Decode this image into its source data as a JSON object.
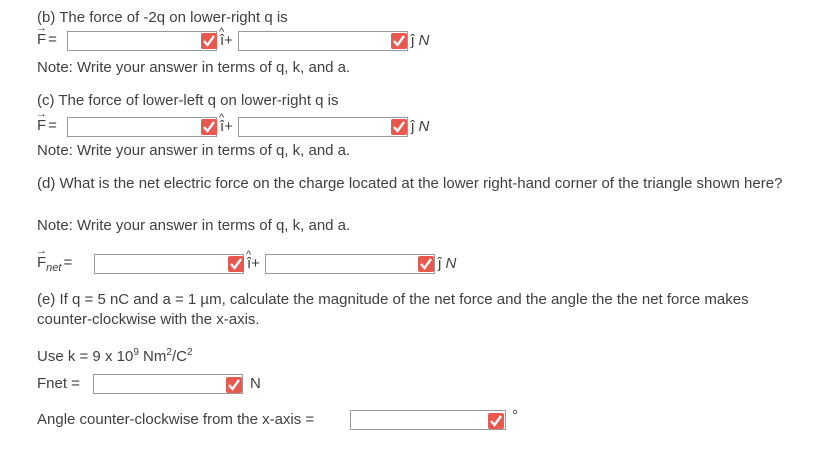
{
  "b": {
    "question": "(b) The force of -2q on lower-right q is",
    "force_symbol": "F",
    "equals": "=",
    "i_unit": "î",
    "plus": "+",
    "j_unit": "ĵ",
    "unit": "N",
    "note": "Note: Write your answer in terms of q, k, and a."
  },
  "c": {
    "question": "(c) The force of lower-left q on lower-right q is",
    "force_symbol": "F",
    "equals": "=",
    "i_unit": "î",
    "plus": "+",
    "j_unit": "ĵ",
    "unit": "N",
    "note": "Note: Write your answer in terms of q, k, and a."
  },
  "d": {
    "question": "(d) What is the net electric force on the charge located at the lower right-hand corner of the triangle shown here?",
    "note": "Note: Write your answer in terms of q, k, and a.",
    "force_symbol": "F",
    "subscript": "net",
    "equals": "=",
    "i_unit": "î",
    "plus": "+",
    "j_unit": "ĵ",
    "unit": "N"
  },
  "e": {
    "question": "(e) If q = 5 nC and a = 1 µm, calculate the magnitude of the net force and the angle the the net force makes counter-clockwise with the x-axis.",
    "use_k_prefix": "Use k = 9 x 10",
    "use_k_exp": "9",
    "use_k_unit": " Nm",
    "use_k_unit_exp1": "2",
    "use_k_unit_mid": "/C",
    "use_k_unit_exp2": "2",
    "fnet_label": "Fnet =",
    "fnet_unit": "N",
    "angle_label": "Angle counter-clockwise from the x-axis =",
    "angle_unit": "°"
  },
  "colors": {
    "check_bg": "#e8584f",
    "text": "#404040",
    "input_border": "#9a9a9a"
  },
  "icons": {
    "check": "check-icon"
  }
}
